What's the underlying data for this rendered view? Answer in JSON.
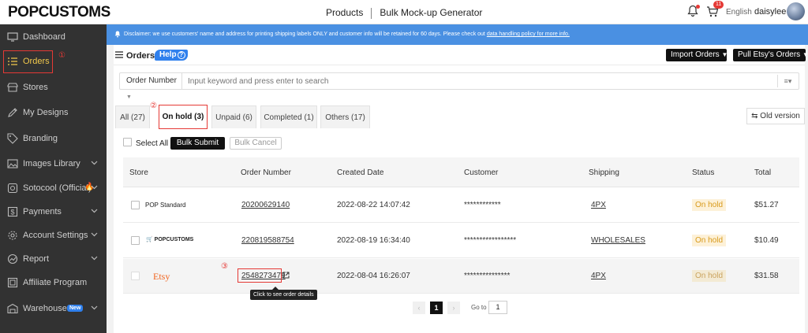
{
  "brand": {
    "logo_text": "POPCUSTOMS"
  },
  "topnav": {
    "products": "Products",
    "mockup": "Bulk Mock-up Generator",
    "cart_count": "11",
    "language": "English",
    "username": "daisylee"
  },
  "sidebar": {
    "items": [
      {
        "label": "Dashboard",
        "icon": "monitor-icon"
      },
      {
        "label": "Orders",
        "icon": "list-icon"
      },
      {
        "label": "Stores",
        "icon": "store-icon"
      },
      {
        "label": "My Designs",
        "icon": "design-icon"
      },
      {
        "label": "Branding",
        "icon": "tag-icon"
      },
      {
        "label": "Images Library",
        "icon": "image-icon"
      },
      {
        "label": "Sotocool (Official)",
        "icon": "box-icon"
      },
      {
        "label": "Payments",
        "icon": "dollar-icon"
      },
      {
        "label": "Account Settings",
        "icon": "gear-icon"
      },
      {
        "label": "Report",
        "icon": "chart-icon"
      },
      {
        "label": "Affiliate Program",
        "icon": "affiliate-icon"
      },
      {
        "label": "Warehouse",
        "icon": "warehouse-icon"
      }
    ],
    "new_badge": "New",
    "callout_1": "①"
  },
  "disclaimer": {
    "text": "Disclaimer: we use customers' name and address for printing shipping labels ONLY and customer info will be retained for 60 days. Please check out",
    "link": "data handling policy for more info."
  },
  "orders_header": {
    "title": "Orders",
    "help": "Help",
    "import_orders": "Import Orders",
    "pull_etsy": "Pull Etsy's Orders"
  },
  "search": {
    "field_select": "Order Number",
    "placeholder": "Input keyword and press enter to search"
  },
  "tabs": [
    {
      "label": "All (27)"
    },
    {
      "label": "On hold (3)"
    },
    {
      "label": "Unpaid (6)"
    },
    {
      "label": "Completed (1)"
    },
    {
      "label": "Others (17)"
    }
  ],
  "callout_2": "②",
  "callout_3": "③",
  "old_version": "Old version",
  "bulk": {
    "select_all": "Select All",
    "submit": "Bulk Submit",
    "cancel": "Bulk Cancel"
  },
  "table": {
    "columns": [
      "Store",
      "Order Number",
      "Created Date",
      "Customer",
      "Shipping",
      "Status",
      "Total"
    ],
    "rows": [
      {
        "store": "POP Standard",
        "order": "20200629140",
        "date": "2022-08-22 14:07:42",
        "customer": "************",
        "shipping": "4PX",
        "status": "On hold",
        "total": "$51.27"
      },
      {
        "store": "POPCUSTOMS",
        "order": "220819588754",
        "date": "2022-08-19 16:34:40",
        "customer": "*****************",
        "shipping": "WHOLESALES",
        "status": "On hold",
        "total": "$10.49"
      },
      {
        "store": "Etsy",
        "order": "2548273479",
        "date": "2022-08-04 16:26:07",
        "customer": "***************",
        "shipping": "4PX",
        "status": "On hold",
        "total": "$31.58"
      }
    ]
  },
  "tooltip": "Click to see order details",
  "pager": {
    "current": "1",
    "goto_label": "Go to",
    "goto_value": "1"
  },
  "colors": {
    "accent_blue": "#2f80ed",
    "banner_blue": "#4a90e2",
    "sidebar_bg": "#323232",
    "active_yellow": "#f2c94c",
    "callout_red": "#e53935",
    "status_bg": "#fdf1d8"
  }
}
